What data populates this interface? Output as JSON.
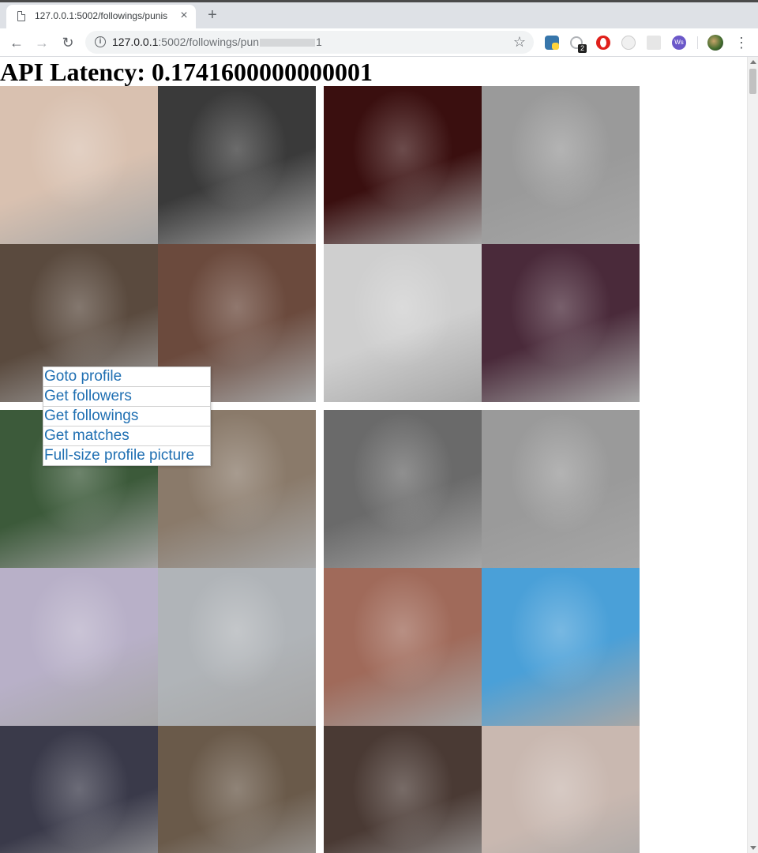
{
  "browser": {
    "tab": {
      "title": "127.0.0.1:5002/followings/punis",
      "close_icon": "×"
    },
    "new_tab_icon": "+",
    "address": {
      "host": "127.0.0.1",
      "path_start": ":5002/followings/pun",
      "path_end": "1"
    },
    "nav_icons": {
      "back": "←",
      "forward": "→",
      "reload": "↻",
      "info": "i",
      "star": "☆",
      "menu": "⋮"
    },
    "extension_badge": "2"
  },
  "page": {
    "latency_label": "API Latency:",
    "latency_value": "0.1741600000000001"
  },
  "context_menu": {
    "items": [
      "Goto profile",
      "Get followers",
      "Get followings",
      "Get matches",
      "Full-size profile picture"
    ]
  },
  "colors": {
    "link": "#1f6fb2",
    "tile_colors": [
      [
        "#d9c1b0",
        "#3a3a3a",
        "#3a0f0f",
        "#9a9a9a"
      ],
      [
        "#5a4a3e",
        "#6b4a3d",
        "#cfcfcf",
        "#4a2a3a"
      ],
      [
        "#3c5a3a",
        "#8a7a6a",
        "#6a6a6a",
        "#9a9a9a"
      ],
      [
        "#b8b0c8",
        "#b0b4b8",
        "#a06a5a",
        "#4aa0d8"
      ],
      [
        "#3a3a4a",
        "#6a5a4a",
        "#4a3a34",
        "#c9b8b0"
      ]
    ]
  }
}
